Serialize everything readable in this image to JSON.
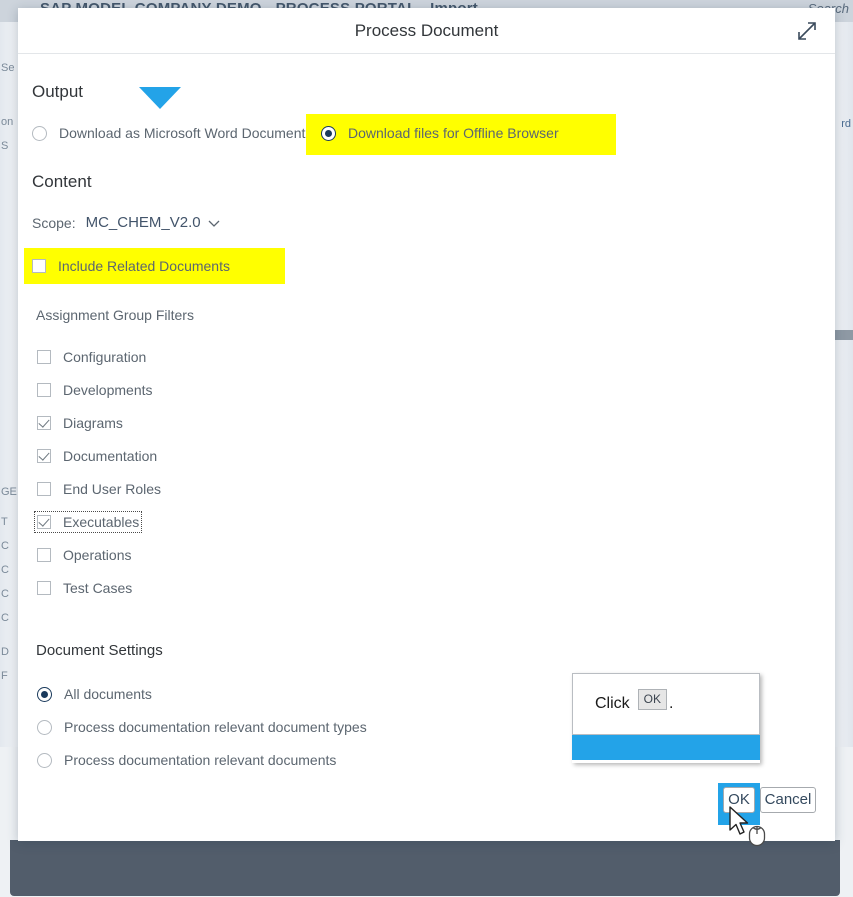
{
  "background": {
    "app_title": "SAP MODEL COMPANY DEMO - PROCESS PORTAL - Import",
    "search_label": "Search",
    "left_fragments": [
      "Se",
      "on",
      "S",
      "GE",
      "T",
      "C",
      "C",
      "C",
      "C",
      "D",
      "F"
    ],
    "right_fragments": [
      "rd"
    ]
  },
  "dialog": {
    "title": "Process Document",
    "expand_icon": "expand-icon",
    "output": {
      "heading": "Output",
      "options": [
        {
          "label": "Download as Microsoft Word Document",
          "selected": false,
          "highlighted": false
        },
        {
          "label": "Download files for Offline Browser",
          "selected": true,
          "highlighted": true
        }
      ]
    },
    "content": {
      "heading": "Content",
      "scope_label": "Scope:",
      "scope_value": "MC_CHEM_V2.0",
      "scope_chevron": "chevron-down-icon",
      "include_related": {
        "label": "Include Related Documents",
        "checked": false,
        "highlighted": true
      }
    },
    "assignment_group_filters": {
      "heading": "Assignment Group Filters",
      "items": [
        {
          "label": "Configuration",
          "checked": false,
          "focused": false
        },
        {
          "label": "Developments",
          "checked": false,
          "focused": false
        },
        {
          "label": "Diagrams",
          "checked": true,
          "focused": false
        },
        {
          "label": "Documentation",
          "checked": true,
          "focused": false
        },
        {
          "label": "End User Roles",
          "checked": false,
          "focused": false
        },
        {
          "label": "Executables",
          "checked": true,
          "focused": true
        },
        {
          "label": "Operations",
          "checked": false,
          "focused": false
        },
        {
          "label": "Test Cases",
          "checked": false,
          "focused": false
        }
      ]
    },
    "document_settings": {
      "heading": "Document Settings",
      "options": [
        {
          "label": "All documents",
          "selected": true
        },
        {
          "label": "Process documentation relevant document types",
          "selected": false
        },
        {
          "label": "Process documentation relevant documents",
          "selected": false
        }
      ]
    },
    "footer": {
      "ok_label": "OK",
      "cancel_label": "Cancel"
    }
  },
  "callout": {
    "text_prefix": "Click",
    "chip_label": "OK",
    "text_suffix": ".",
    "accent_color": "#23a3e8"
  },
  "colors": {
    "highlight_yellow": "#ffff00",
    "accent_blue": "#23a3e8",
    "footer_bar": "#525d6b",
    "text_primary": "#32363a",
    "text_secondary": "#5c6670"
  }
}
